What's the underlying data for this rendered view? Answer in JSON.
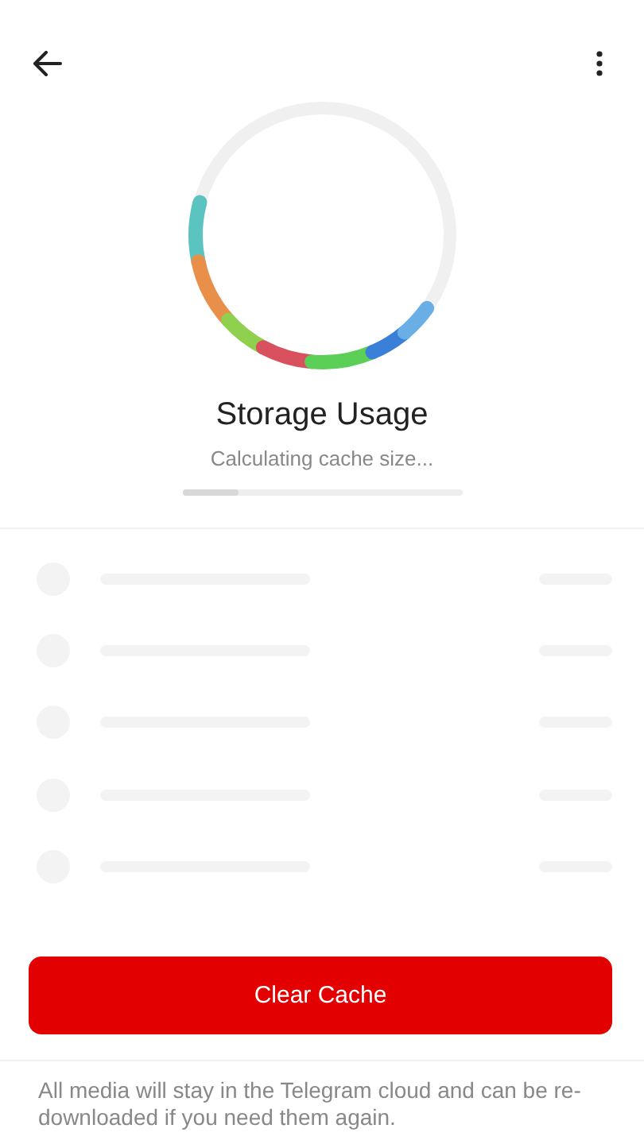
{
  "header": {
    "title": "Storage Usage",
    "subtitle": "Calculating cache size..."
  },
  "progress": {
    "level": 0.2
  },
  "button": "Clear Cache",
  "note": "All media will stay in the Telegram cloud and can be re-downloaded if you need them again."
}
